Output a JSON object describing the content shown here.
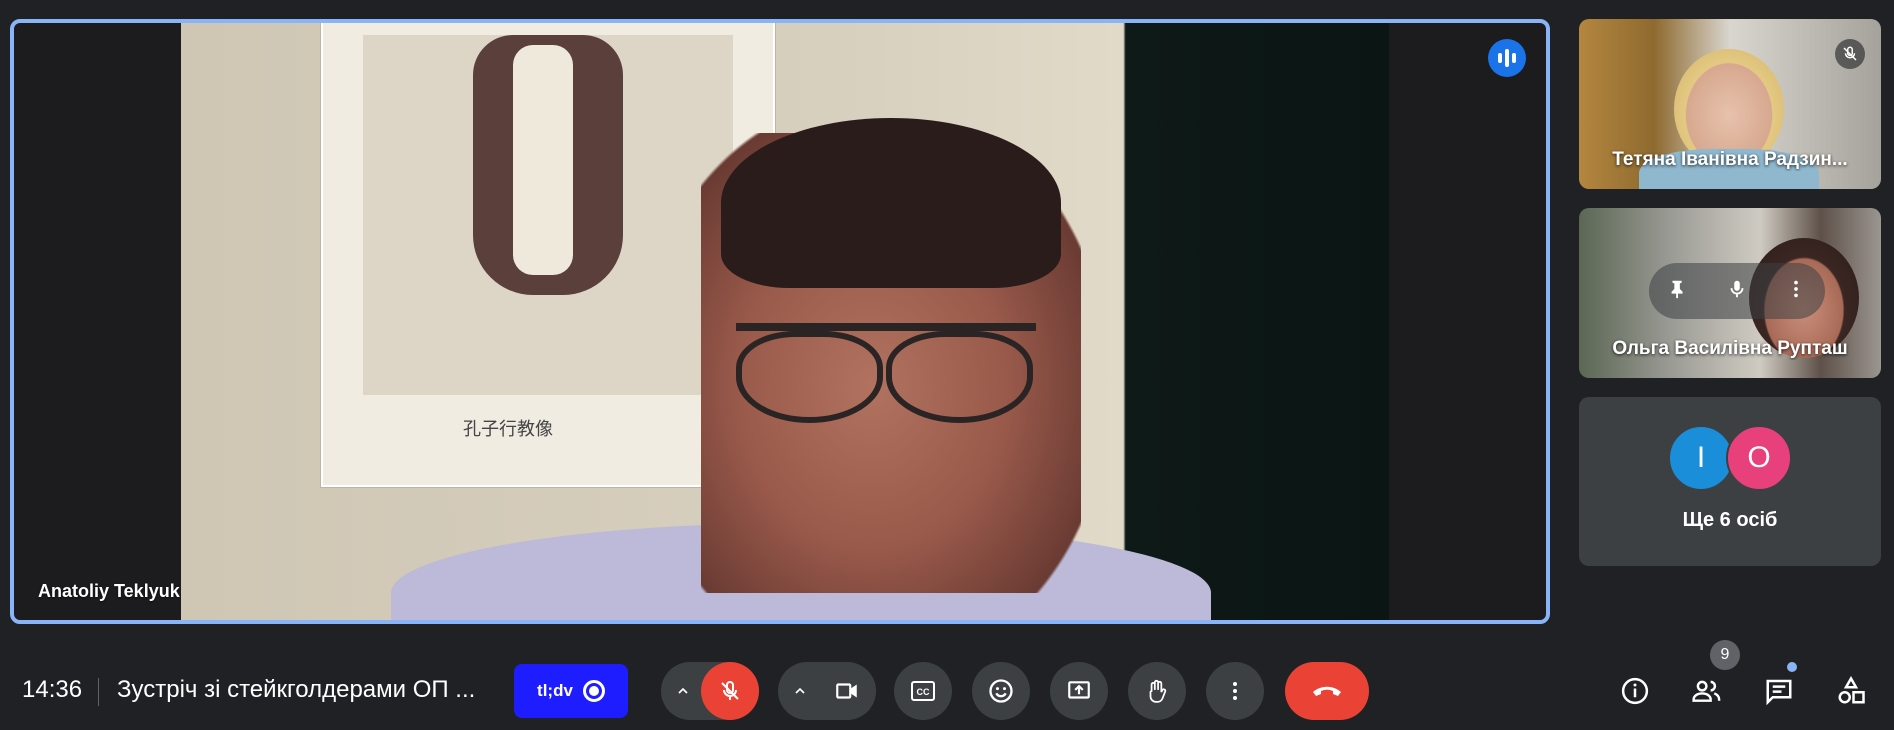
{
  "main_speaker": {
    "name": "Anatoliy Teklyuk",
    "poster_caption": "孔子行教像"
  },
  "participants": [
    {
      "name": "Тетяна Іванівна Радзин...",
      "muted": true
    },
    {
      "name": "Ольга Василівна Рупташ"
    }
  ],
  "others": {
    "avatars": [
      {
        "letter": "I",
        "color": "#1a8ed8"
      },
      {
        "letter": "O",
        "color": "#e8407a"
      }
    ],
    "label": "Ще 6 осіб"
  },
  "bottom_bar": {
    "time": "14:36",
    "meeting_title": "Зустріч зі стейкголдерами ОП ...",
    "tldv_label": "tl;dv",
    "people_count": "9"
  },
  "colors": {
    "accent": "#8ab4f8",
    "hangup": "#ea4335",
    "tldv": "#1d1dff",
    "bg": "#202124"
  }
}
